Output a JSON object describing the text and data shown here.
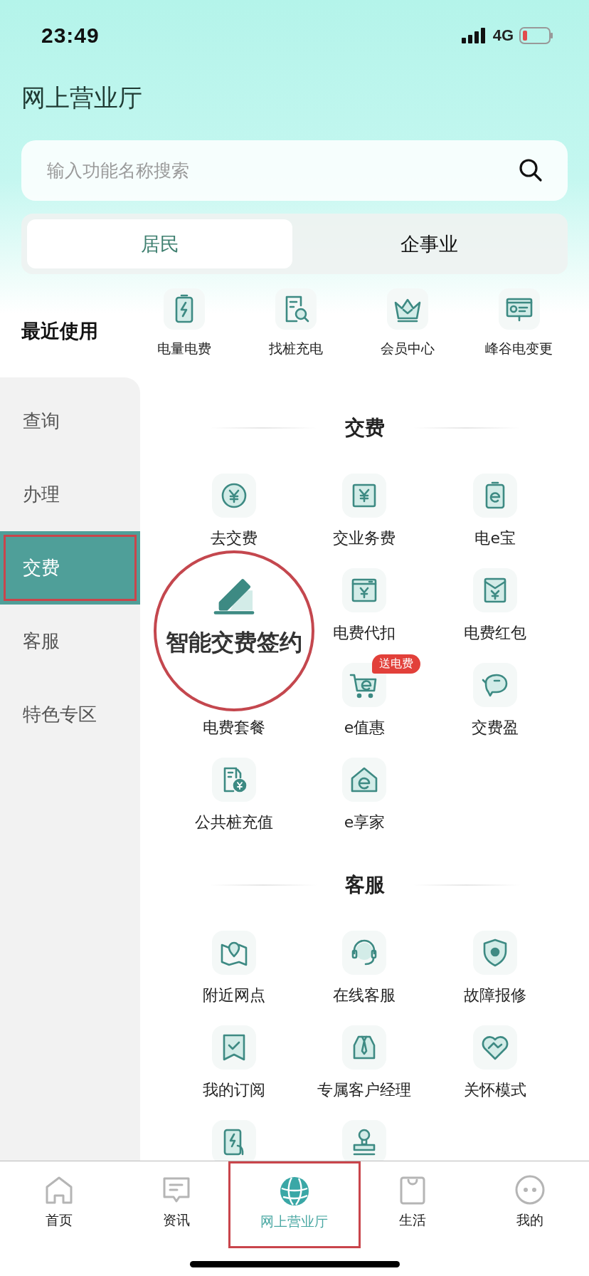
{
  "status_bar": {
    "time": "23:49",
    "network": "4G"
  },
  "title": "网上营业厅",
  "search": {
    "placeholder": "输入功能名称搜索"
  },
  "segments": [
    {
      "label": "居民",
      "selected": true
    },
    {
      "label": "企事业",
      "selected": false
    }
  ],
  "recent": {
    "label": "最近使用",
    "items": [
      {
        "label": "电量电费"
      },
      {
        "label": "找桩充电"
      },
      {
        "label": "会员中心"
      },
      {
        "label": "峰谷电变更"
      }
    ]
  },
  "sidebar": {
    "items": [
      {
        "label": "查询",
        "selected": false,
        "highlighted": false
      },
      {
        "label": "办理",
        "selected": false,
        "highlighted": false
      },
      {
        "label": "交费",
        "selected": true,
        "highlighted": true
      },
      {
        "label": "客服",
        "selected": false,
        "highlighted": false
      },
      {
        "label": "特色专区",
        "selected": false,
        "highlighted": false
      }
    ]
  },
  "sections": [
    {
      "title": "交费",
      "items": [
        {
          "kind": "item",
          "label": "去交费"
        },
        {
          "kind": "item",
          "label": "交业务费"
        },
        {
          "kind": "item",
          "label": "电e宝"
        },
        {
          "kind": "magnified",
          "label": "智能交费签约"
        },
        {
          "kind": "item",
          "label": "电费代扣"
        },
        {
          "kind": "item",
          "label": "电费红包"
        },
        {
          "kind": "item",
          "label": "电费套餐"
        },
        {
          "kind": "item",
          "label": "e值惠",
          "badge": "送电费"
        },
        {
          "kind": "item",
          "label": "交费盈"
        },
        {
          "kind": "item",
          "label": "公共桩充值"
        },
        {
          "kind": "item",
          "label": "e享家"
        }
      ]
    },
    {
      "title": "客服",
      "items": [
        {
          "kind": "item",
          "label": "附近网点"
        },
        {
          "kind": "item",
          "label": "在线客服"
        },
        {
          "kind": "item",
          "label": "故障报修"
        },
        {
          "kind": "item",
          "label": "我的订阅"
        },
        {
          "kind": "item",
          "label": "专属客户经理"
        },
        {
          "kind": "item",
          "label": "关怀模式"
        },
        {
          "kind": "partial"
        },
        {
          "kind": "partial"
        }
      ]
    }
  ],
  "tab_bar": {
    "items": [
      {
        "label": "首页",
        "selected": false,
        "highlighted": false
      },
      {
        "label": "资讯",
        "selected": false,
        "highlighted": false
      },
      {
        "label": "网上营业厅",
        "selected": true,
        "highlighted": true
      },
      {
        "label": "生活",
        "selected": false,
        "highlighted": false
      },
      {
        "label": "我的",
        "selected": false,
        "highlighted": false
      }
    ]
  }
}
